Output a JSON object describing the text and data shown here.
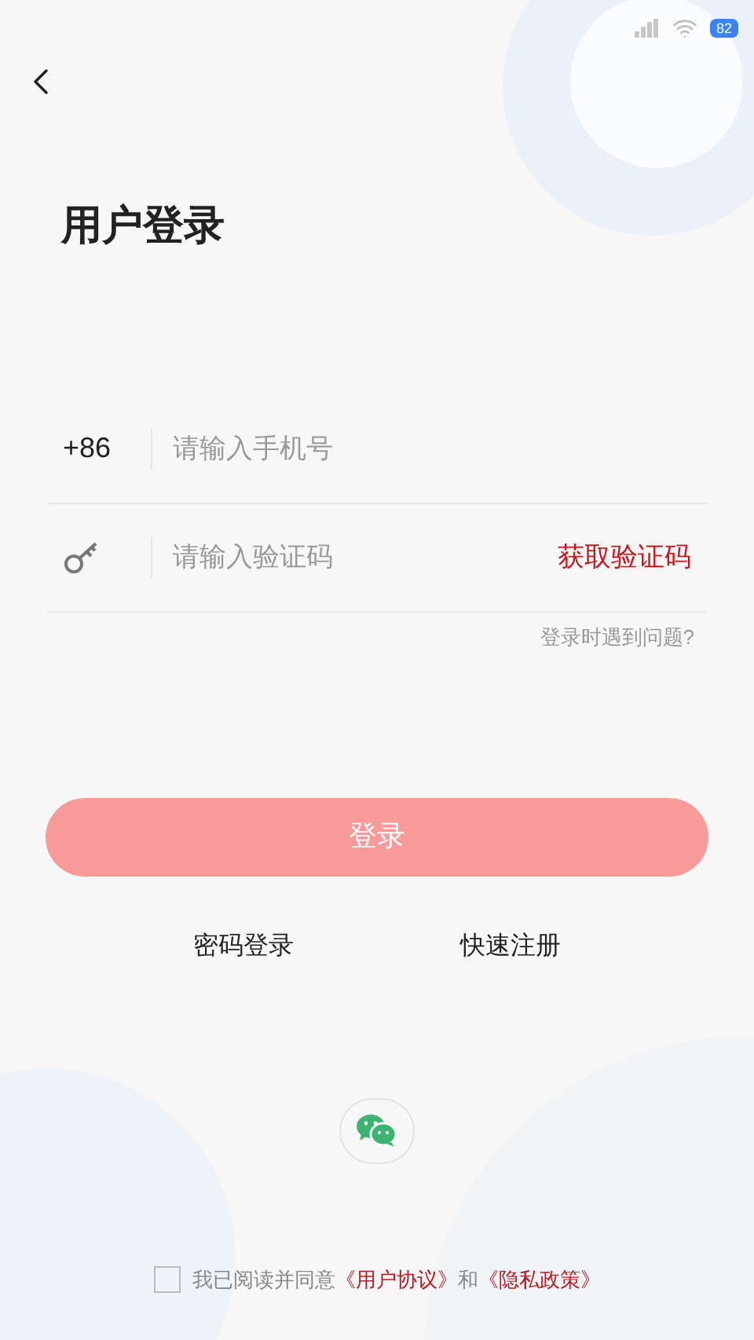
{
  "status_bar": {
    "battery": "82"
  },
  "title": "用户登录",
  "phone": {
    "prefix": "+86",
    "placeholder": "请输入手机号"
  },
  "code": {
    "placeholder": "请输入验证码",
    "action": "获取验证码"
  },
  "help_link": "登录时遇到问题?",
  "login_button": {
    "label": "登录",
    "disabled": true
  },
  "links": [
    "密码登录",
    "快速注册"
  ],
  "agreement": {
    "checked": false,
    "text": "我已阅读并同意",
    "terms": "《用户协议》",
    "and": "和",
    "privacy": "《隐私政策》"
  }
}
